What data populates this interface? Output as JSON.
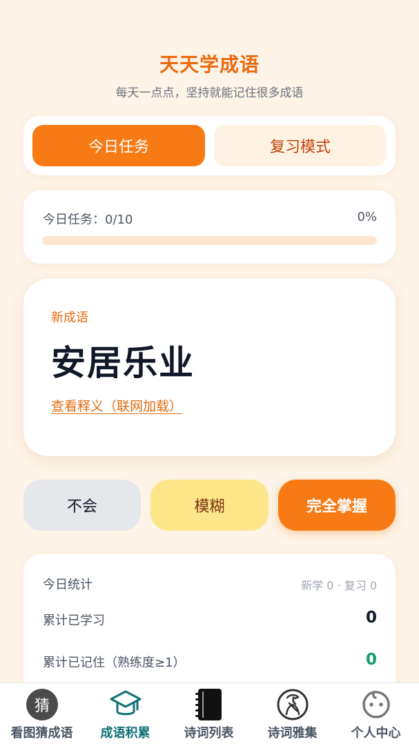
{
  "header": {
    "title": "天天学成语",
    "subtitle": "每天一点点，坚持就能记住很多成语"
  },
  "modes": {
    "today_label": "今日任务",
    "review_label": "复习模式"
  },
  "progress": {
    "label": "今日任务：0/10",
    "percent_text": "0%",
    "fraction": 0
  },
  "idiom": {
    "tag": "新成语",
    "word": "安居乐业",
    "link_text": "查看释义（联网加载）"
  },
  "rating": {
    "no_label": "不会",
    "fuzzy_label": "模糊",
    "master_label": "完全掌握"
  },
  "stats": {
    "title": "今日统计",
    "summary": "新学 0 · 复习 0",
    "rows": [
      {
        "label": "累计已学习",
        "value": "0"
      },
      {
        "label": "累计已记住（熟练度≥1）",
        "value": "0"
      }
    ]
  },
  "tabbar": {
    "guess_glyph": "猜",
    "items": [
      {
        "label": "看图猜成语",
        "icon": "guess-icon"
      },
      {
        "label": "成语积累",
        "icon": "graduation-cap-icon"
      },
      {
        "label": "诗词列表",
        "icon": "notebook-icon"
      },
      {
        "label": "诗词雅集",
        "icon": "poet-icon"
      },
      {
        "label": "个人中心",
        "icon": "smiley-icon"
      }
    ]
  },
  "colors": {
    "accent": "#f77a15",
    "title": "#ea6a10",
    "background": "#fdf3e6",
    "active_tab": "#0f6f73",
    "success": "#0f9d70"
  }
}
